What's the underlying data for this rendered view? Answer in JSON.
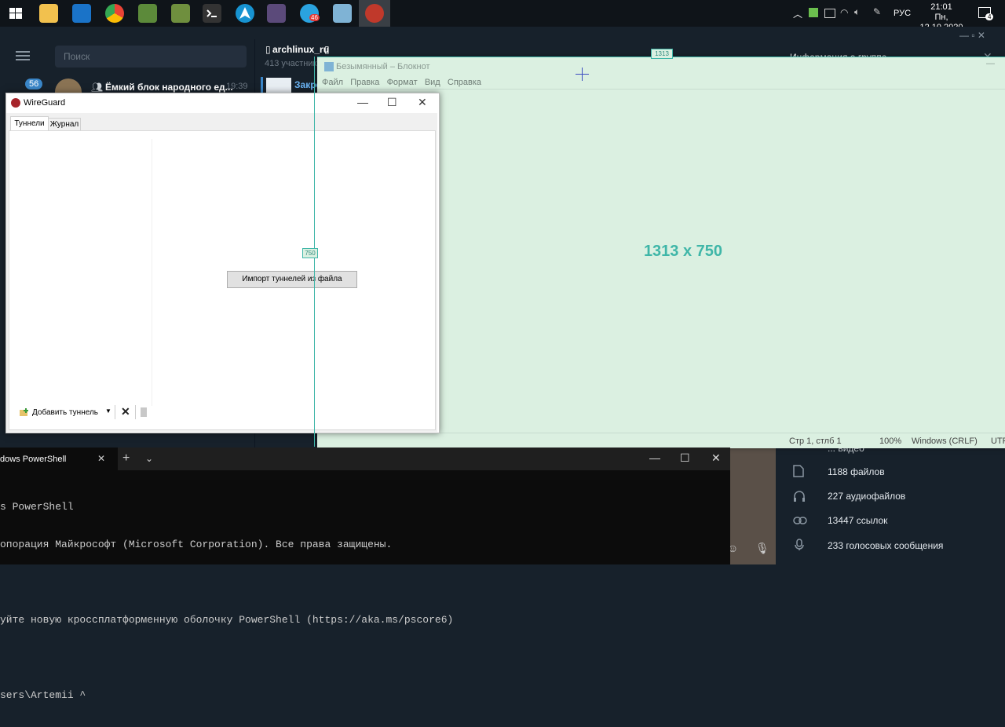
{
  "colors": {
    "taskbar": "#0f1419",
    "telegram_bg": "#17212b",
    "notepad_bg": "#dbf0e1",
    "accent": "#3fb6a8",
    "badge": "#3a86c8"
  },
  "taskbar": {
    "lang": "РУС",
    "time": "21:01",
    "date": "Пн, 12.10.2020",
    "notif_count": "4",
    "telegram_badge": "46"
  },
  "telegram": {
    "search_placeholder": "Поиск",
    "unread_badge": "56",
    "chat_title": "Ёмкий блок народного ед...",
    "chat_time": "19:39",
    "channel_name": "archlinux_ru",
    "channel_members": "413 участник",
    "pinned": "Закре",
    "info_title": "Информация о группе",
    "stats": [
      {
        "icon": "file-icon",
        "label": "1188 файлов"
      },
      {
        "icon": "headphones-icon",
        "label": "227 аудиофайлов"
      },
      {
        "icon": "link-icon",
        "label": "13447 ссылок"
      },
      {
        "icon": "mic-icon",
        "label": "233 голосовых сообщения"
      }
    ],
    "stats_partial": "... видео"
  },
  "wireguard": {
    "title": "WireGuard",
    "tabs": [
      "Туннели",
      "Журнал"
    ],
    "import_button": "Импорт туннелей из файла",
    "add_tunnel": "Добавить туннель"
  },
  "notepad": {
    "title": "Безымянный – Блокнот",
    "menu": [
      "Файл",
      "Правка",
      "Формат",
      "Вид",
      "Справка"
    ],
    "status_pos": "Стр 1, стлб 1",
    "status_zoom": "100%",
    "status_eol": "Windows (CRLF)",
    "status_enc": "UTF"
  },
  "overlay": {
    "size_label": "1313 x 750",
    "width_tag": "1313",
    "height_tag": "750"
  },
  "powershell": {
    "tab_title": "dows PowerShell",
    "lines": [
      "s PowerShell",
      "опорация Майкрософт (Microsoft Corporation). Все права защищены.",
      "",
      "уйте новую кроссплатформенную оболочку PowerShell (https://aka.ms/pscore6)",
      "",
      "sers\\Artemii ^"
    ]
  }
}
